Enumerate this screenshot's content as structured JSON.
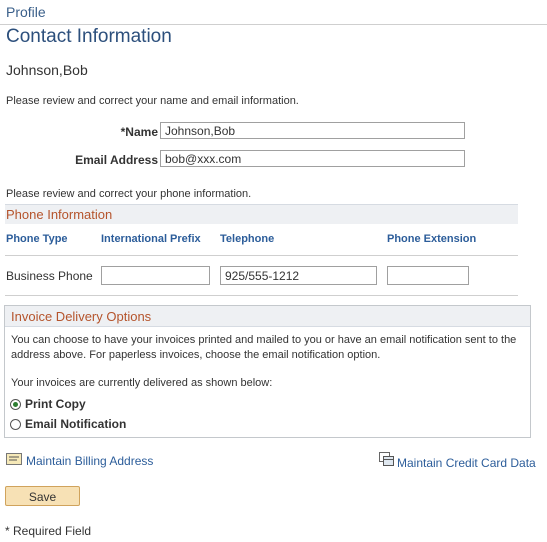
{
  "breadcrumb": "Profile",
  "page_title": "Contact Information",
  "person_name": "Johnson,Bob",
  "name_note": "Please review and correct your name and email information.",
  "name_field": {
    "label": "*Name",
    "value": "Johnson,Bob"
  },
  "email_field": {
    "label": "Email Address",
    "value": "bob@xxx.com"
  },
  "phone_note": "Please review and correct your phone information.",
  "phone_section": {
    "title": "Phone Information",
    "columns": [
      "Phone Type",
      "International Prefix",
      "Telephone",
      "Phone Extension"
    ],
    "rows": [
      {
        "type": "Business Phone",
        "prefix": "",
        "telephone": "925/555-1212",
        "extension": ""
      }
    ]
  },
  "invoice": {
    "title": "Invoice Delivery Options",
    "description": "You can choose to have your invoices printed and mailed to you or have an email notification sent to the address above. For paperless invoices, choose the email notification option.",
    "current_note": "Your invoices are currently delivered as shown below:",
    "options": [
      {
        "label": "Print Copy",
        "selected": true
      },
      {
        "label": "Email Notification",
        "selected": false
      }
    ]
  },
  "links": {
    "billing_address": "Maintain Billing Address",
    "credit_card": "Maintain Credit Card Data"
  },
  "icons": {
    "billing_address": "address-card-icon",
    "credit_card": "credit-card-icon"
  },
  "save_label": "Save",
  "required_note": "* Required Field",
  "colors": {
    "link": "#2c5d9a",
    "section_title": "#b5542c",
    "button": "#f7e1b5"
  }
}
